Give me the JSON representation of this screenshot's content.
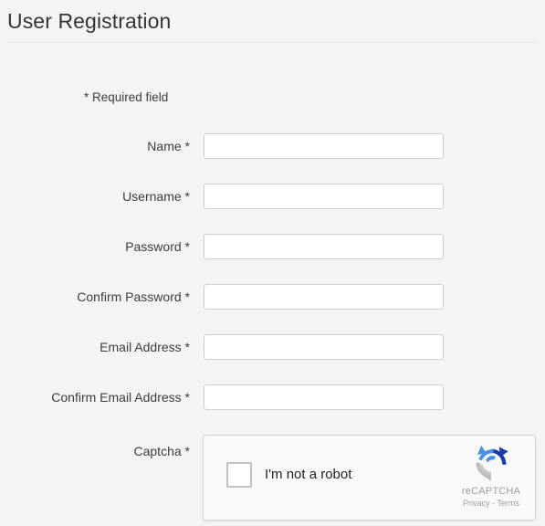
{
  "page": {
    "title": "User Registration",
    "background_color": "#f4f4f4",
    "title_color": "#353535",
    "divider_color": "#e3e3e3"
  },
  "form": {
    "required_note": "* Required field",
    "required_marker": "*",
    "fields": [
      {
        "label": "Name",
        "required_marker": "*",
        "value": "",
        "placeholder": "",
        "type": "text",
        "name": "name"
      },
      {
        "label": "Username",
        "required_marker": "*",
        "value": "",
        "placeholder": "",
        "type": "text",
        "name": "username"
      },
      {
        "label": "Password",
        "required_marker": "*",
        "value": "",
        "placeholder": "",
        "type": "password",
        "name": "password"
      },
      {
        "label": "Confirm Password",
        "required_marker": "*",
        "value": "",
        "placeholder": "",
        "type": "password",
        "name": "confirm-password"
      },
      {
        "label": "Email Address",
        "required_marker": "*",
        "value": "",
        "placeholder": "",
        "type": "text",
        "name": "email-address"
      },
      {
        "label": "Confirm Email Address",
        "required_marker": "*",
        "value": "",
        "placeholder": "",
        "type": "text",
        "name": "confirm-email-address"
      }
    ],
    "captcha": {
      "label": "Captcha",
      "required_marker": "*",
      "checkbox_label": "I'm not a robot",
      "checked": false,
      "brand": "reCAPTCHA",
      "privacy_terms": "Privacy - Terms",
      "icon": "recaptcha-logo-icon",
      "colors": {
        "light_blue": "#4a90e2",
        "dark_blue": "#1c3aa9",
        "gray": "#bdbdbd",
        "widget_background": "#f9f9f9",
        "widget_border": "#d3d3d3",
        "brand_text": "#9aa0a6"
      }
    }
  }
}
